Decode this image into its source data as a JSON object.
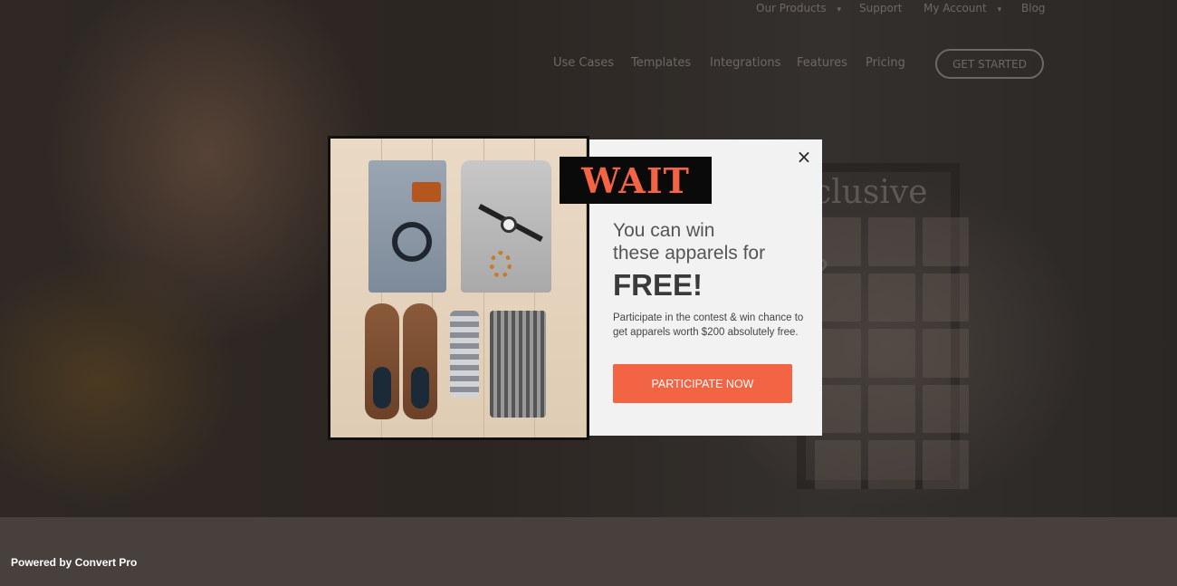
{
  "top_nav": {
    "items": [
      "Our Products",
      "Support",
      "My Account",
      "Blog"
    ],
    "dropdown_arrow": "▾"
  },
  "main_nav": {
    "items": [
      "Use Cases",
      "Templates",
      "Integrations",
      "Features",
      "Pricing"
    ],
    "cta": "GET STARTED"
  },
  "background": {
    "headline_fragment": "clusive",
    "question_fragment": "?"
  },
  "popup": {
    "badge": "WAIT",
    "close_icon": "×",
    "headline_line1": "You can win",
    "headline_line2": "these apparels for",
    "highlight": "FREE!",
    "body": "Participate in the contest & win chance to get apparels worth $200 absolutely free.",
    "cta": "PARTICIPATE NOW",
    "accent_color": "#f26444"
  },
  "footer": {
    "powered_by": "Powered by Convert Pro"
  }
}
